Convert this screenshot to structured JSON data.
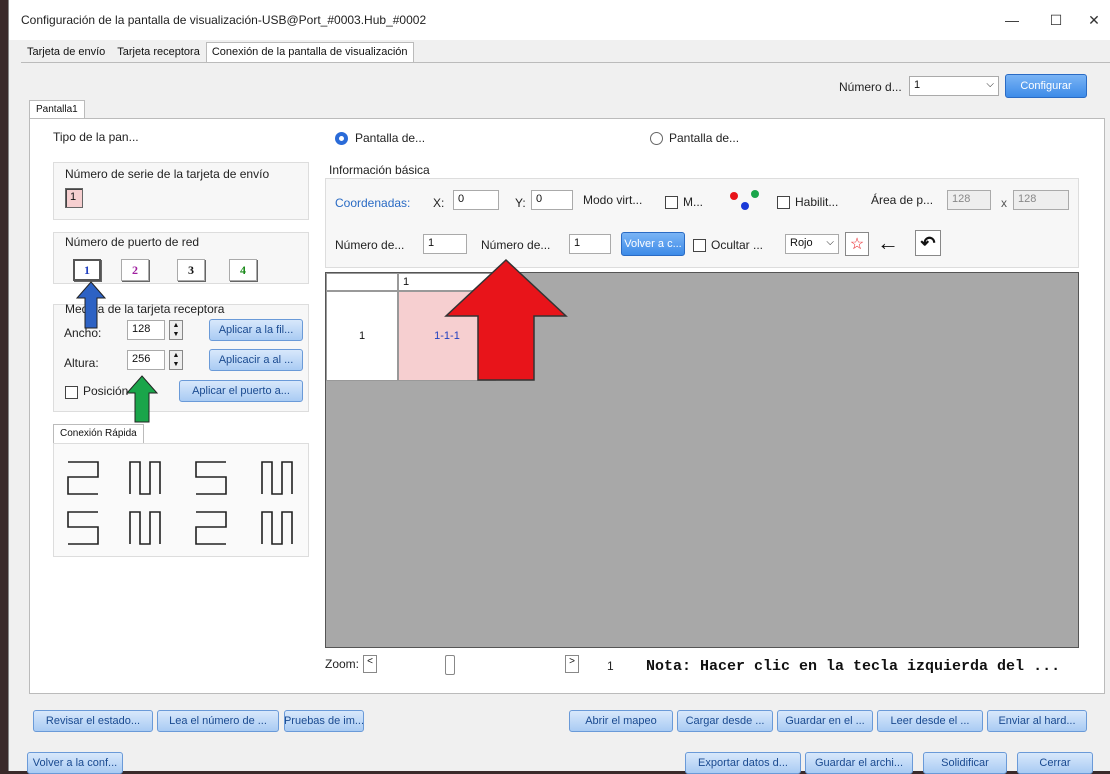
{
  "window": {
    "title": "Configuración de la pantalla de visualización-USB@Port_#0003.Hub_#0002",
    "minimize": "—",
    "maximize": "☐",
    "close": "✕"
  },
  "tabs": [
    "Tarjeta de envío",
    "Tarjeta receptora",
    "Conexión de la pantalla de visualización"
  ],
  "top": {
    "numero_label": "Número d...",
    "numero_value": "1",
    "configurar": "Configurar"
  },
  "screen_tab": "Pantalla1",
  "tipo": {
    "label": "Tipo de la pan...",
    "opt1": "Pantalla de...",
    "opt2": "Pantalla de..."
  },
  "serie": {
    "label": "Número de serie de la tarjeta de envío",
    "value": "1"
  },
  "puerto": {
    "label": "Número de puerto de red",
    "ports": [
      "1",
      "2",
      "3",
      "4"
    ]
  },
  "medida": {
    "label": "Medida de la tarjeta receptora",
    "ancho_label": "Ancho:",
    "ancho": "128",
    "altura_label": "Altura:",
    "altura": "256",
    "aplicar_fila": "Aplicar a la fil...",
    "aplicar_al": "Aplicacir a al ...",
    "posicion": "Posición",
    "aplicar_puerto": "Aplicar el puerto a..."
  },
  "conexion": {
    "label": "Conexión Rápida"
  },
  "info": {
    "label": "Información básica",
    "coord": "Coordenadas:",
    "x_label": "X:",
    "x": "0",
    "y_label": "Y:",
    "y": "0",
    "modo": "Modo virt...",
    "m": "M...",
    "habil": "Habilit...",
    "area": "Área de p...",
    "area_w": "128",
    "area_x": "x",
    "area_h": "128",
    "num1_label": "Número de...",
    "num1": "1",
    "num2_label": "Número de...",
    "num2": "1",
    "volver": "Volver a c...",
    "ocultar": "Ocultar ...",
    "color": "Rojo"
  },
  "grid": {
    "col": "1",
    "row": "1",
    "cell": "1-1-1"
  },
  "zoom": {
    "label": "Zoom:",
    "value": "1",
    "left": "<",
    "right": ">"
  },
  "nota": "Nota: Hacer clic en la tecla izquierda del ...",
  "bottom1": [
    "Revisar el estado...",
    "Lea el número de ...",
    "Pruebas de im...",
    "Abrir el mapeo",
    "Cargar desde ...",
    "Guardar en el ...",
    "Leer desde el ...",
    "Enviar al hard..."
  ],
  "bottom2": [
    "Volver a la conf...",
    "Exportar datos d...",
    "Guardar el archi...",
    "Solidificar",
    "Cerrar"
  ],
  "colors": {
    "accent": "#3d8be8",
    "arrow_red": "#e8141a",
    "arrow_blue": "#2d62c4",
    "arrow_green": "#1aa54a",
    "cell_pink": "#f6cfd0"
  }
}
